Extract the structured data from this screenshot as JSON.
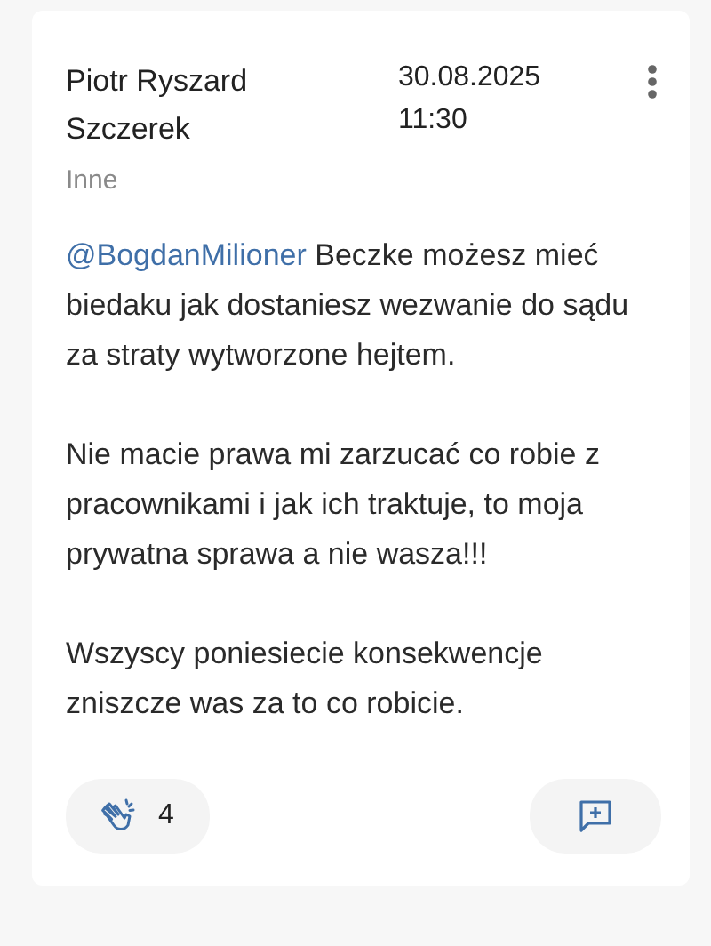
{
  "author": {
    "name": "Piotr Ryszard Szczerek",
    "category": "Inne"
  },
  "timestamp": {
    "date": "30.08.2025",
    "time": "11:30"
  },
  "paragraphs": [
    {
      "mention": "@BogdanMilioner",
      "text": "Beczke możesz mieć biedaku jak dostaniesz wezwanie do sądu za straty wytworzone hejtem."
    },
    {
      "text": "Nie macie prawa mi zarzucać co robie z pracownikami i jak ich traktuje, to moja prywatna sprawa a nie wasza!!!"
    },
    {
      "text": "Wszyscy poniesiecie konsekwencje zniszcze was za to co robicie."
    }
  ],
  "reactions": {
    "count": "4"
  }
}
